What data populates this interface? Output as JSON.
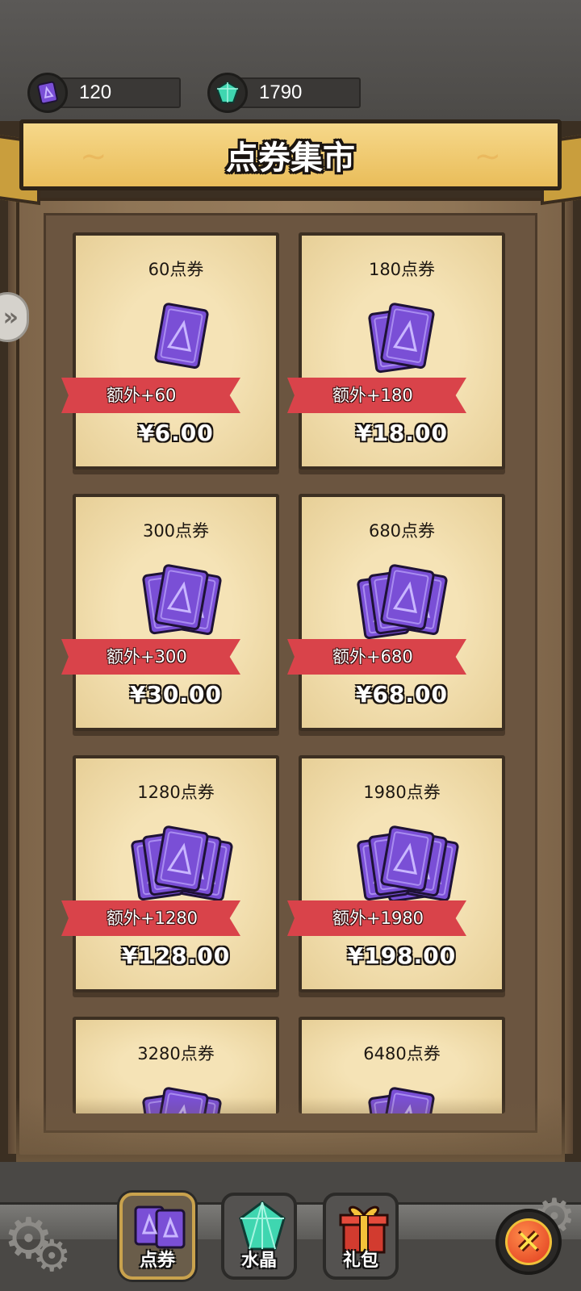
{
  "currencies": [
    {
      "icon": "voucher-icon",
      "value": "120"
    },
    {
      "icon": "crystal-icon",
      "value": "1790"
    }
  ],
  "banner": {
    "title": "点券集市"
  },
  "items": [
    {
      "title": "60点券",
      "bonus": "额外+60",
      "price": "¥6.00",
      "stack": 1
    },
    {
      "title": "180点券",
      "bonus": "额外+180",
      "price": "¥18.00",
      "stack": 2
    },
    {
      "title": "300点券",
      "bonus": "额外+300",
      "price": "¥30.00",
      "stack": 3
    },
    {
      "title": "680点券",
      "bonus": "额外+680",
      "price": "¥68.00",
      "stack": 4
    },
    {
      "title": "1280点券",
      "bonus": "额外+1280",
      "price": "¥128.00",
      "stack": 5
    },
    {
      "title": "1980点券",
      "bonus": "额外+1980",
      "price": "¥198.00",
      "stack": 6
    },
    {
      "title": "3280点券",
      "stack": 3
    },
    {
      "title": "6480点券",
      "stack": 2
    }
  ],
  "tabs": [
    {
      "label": "点券",
      "icon": "voucher-icon",
      "active": true
    },
    {
      "label": "水晶",
      "icon": "crystal-icon",
      "active": false
    },
    {
      "label": "礼包",
      "icon": "gift-icon",
      "active": false
    }
  ],
  "colors": {
    "voucher": "#7a4fd6",
    "ribbon": "#d9434a",
    "crystal": "#3fd6b0"
  }
}
